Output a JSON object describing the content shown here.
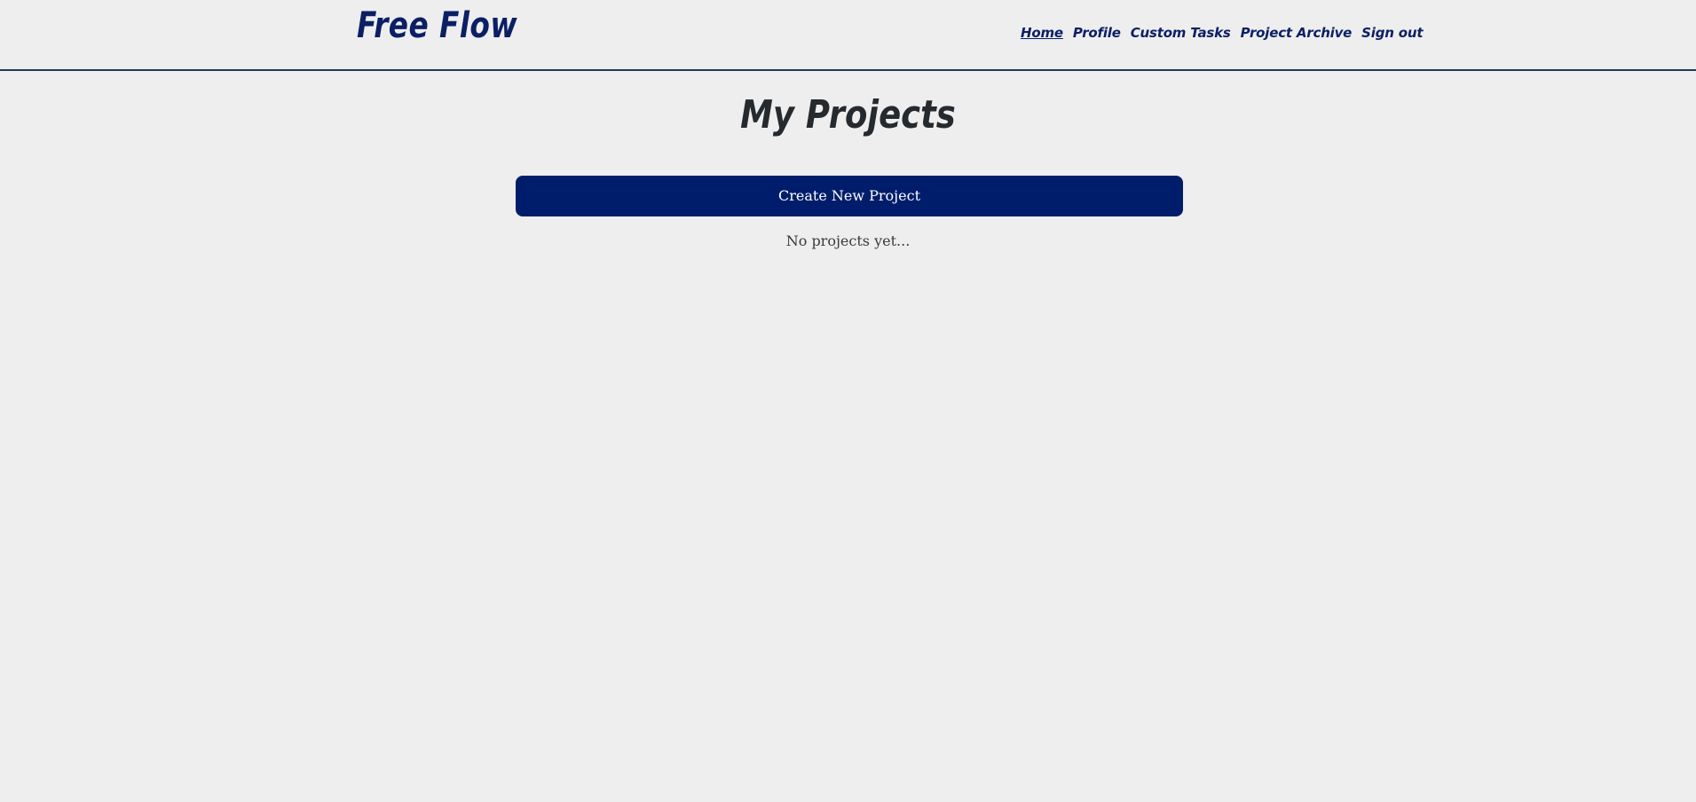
{
  "header": {
    "brand": "Free Flow",
    "nav": [
      {
        "label": "Home",
        "active": true
      },
      {
        "label": "Profile",
        "active": false
      },
      {
        "label": "Custom Tasks",
        "active": false
      },
      {
        "label": "Project Archive",
        "active": false
      },
      {
        "label": "Sign out",
        "active": false
      }
    ]
  },
  "main": {
    "title": "My Projects",
    "create_button_label": "Create New Project",
    "empty_message": "No projects yet..."
  },
  "colors": {
    "brand": "#0b1f64",
    "button_bg": "#001d6c",
    "background": "#eeeeee",
    "header_border": "#1f3a5c"
  }
}
